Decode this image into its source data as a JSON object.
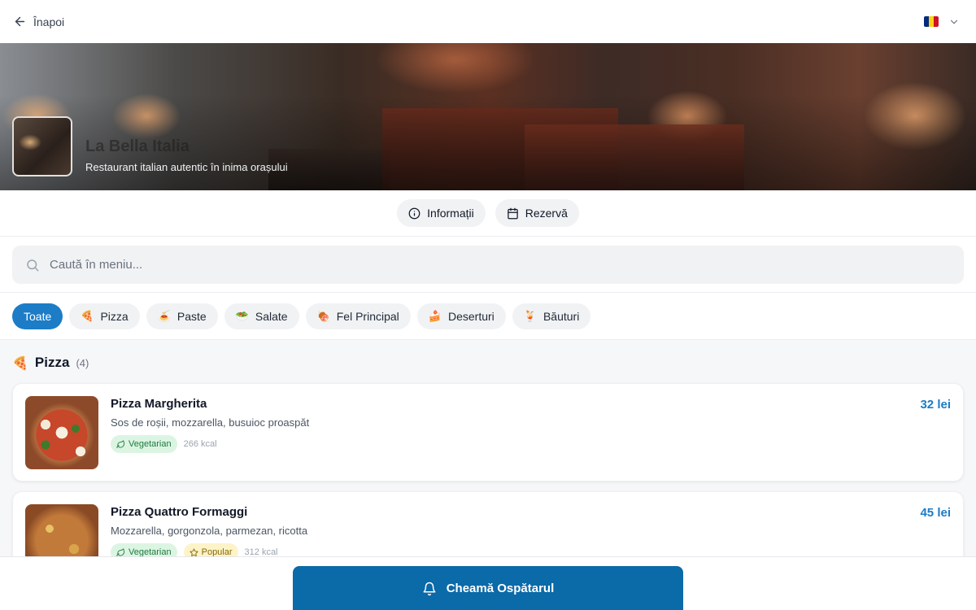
{
  "header": {
    "back_label": "Înapoi",
    "language_flag": "romania-flag-icon"
  },
  "hero": {
    "title": "La Bella Italia",
    "subtitle": "Restaurant italian autentic în inima orașului"
  },
  "actions": {
    "info_label": "Informații",
    "reserve_label": "Rezervă"
  },
  "search": {
    "placeholder": "Caută în meniu..."
  },
  "categories": [
    {
      "label": "Toate",
      "icon": "",
      "active": true
    },
    {
      "label": "Pizza",
      "icon": "🍕",
      "active": false
    },
    {
      "label": "Paste",
      "icon": "🍝",
      "active": false
    },
    {
      "label": "Salate",
      "icon": "🥗",
      "active": false
    },
    {
      "label": "Fel Principal",
      "icon": "🍖",
      "active": false
    },
    {
      "label": "Deserturi",
      "icon": "🍰",
      "active": false
    },
    {
      "label": "Băuturi",
      "icon": "🍹",
      "active": false
    }
  ],
  "section": {
    "icon": "🍕",
    "title": "Pizza",
    "count": "(4)"
  },
  "items": [
    {
      "name": "Pizza Margherita",
      "description": "Sos de roșii, mozzarella, busuioc proaspăt",
      "tags": [
        "Vegetarian"
      ],
      "kcal": "266 kcal",
      "price": "32 lei"
    },
    {
      "name": "Pizza Quattro Formaggi",
      "description": "Mozzarella, gorgonzola, parmezan, ricotta",
      "tags": [
        "Vegetarian",
        "Popular"
      ],
      "kcal": "312 kcal",
      "price": "45 lei"
    }
  ],
  "bottom": {
    "call_waiter_label": "Cheamă Ospătarul"
  },
  "colors": {
    "accent": "#1c7cc6",
    "call_button": "#0b6aa8",
    "vegetarian_bg": "#dcf5e3",
    "popular_bg": "#fdf3c8"
  }
}
